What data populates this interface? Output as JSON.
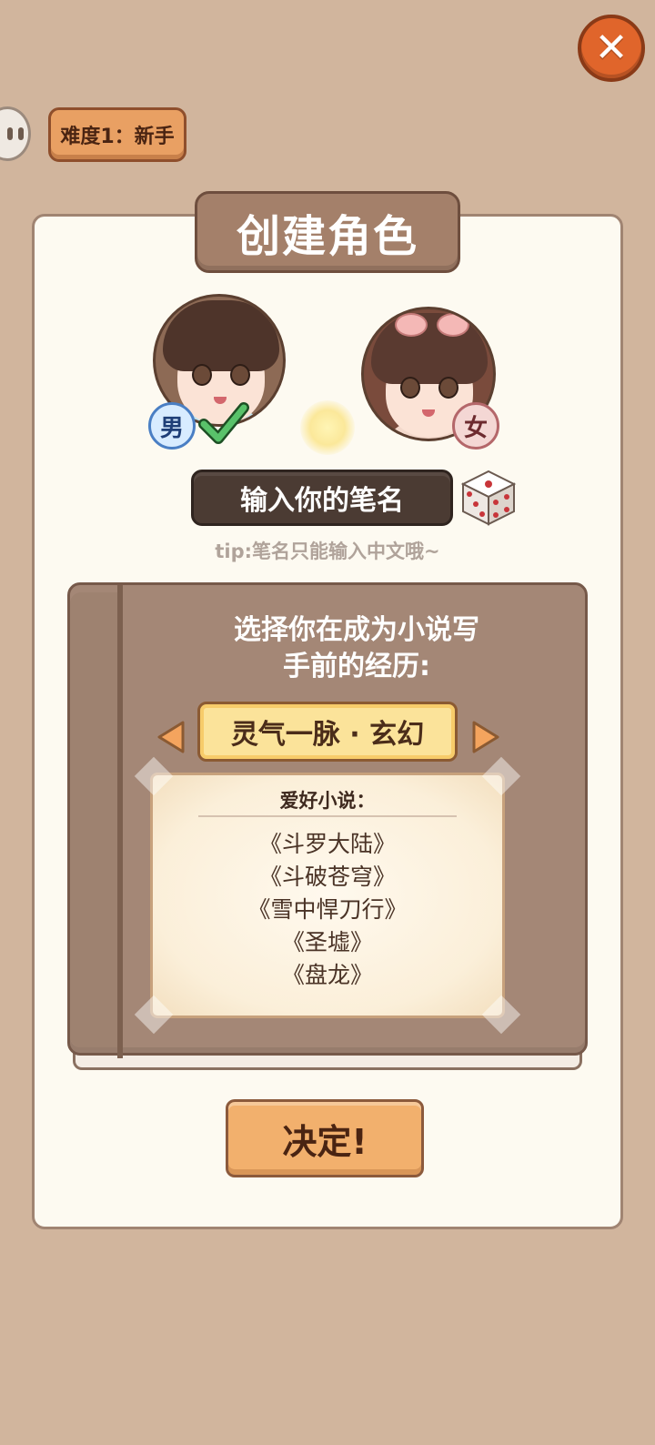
{
  "header": {
    "close_icon": "close-icon",
    "difficulty_label": "难度1：新手"
  },
  "card": {
    "title": "创建角色",
    "gender": {
      "male_label": "男",
      "female_label": "女",
      "selected": "男"
    },
    "name_input": {
      "value": "输入你的笔名"
    },
    "tip": "tip:笔名只能输入中文哦~"
  },
  "book": {
    "question_line1": "选择你在成为小说写",
    "question_line2": "手前的经历:",
    "world_selector": "灵气一脉 · 玄幻",
    "hobby_heading": "爱好小说：",
    "novels": [
      "《斗罗大陆》",
      "《斗破苍穹》",
      "《雪中悍刀行》",
      "《圣墟》",
      "《盘龙》"
    ]
  },
  "confirm_label": "决定!",
  "colors": {
    "background": "#d1b59d",
    "accent_orange": "#e0652b",
    "card": "#fdfaf1",
    "book": "#a48776"
  }
}
